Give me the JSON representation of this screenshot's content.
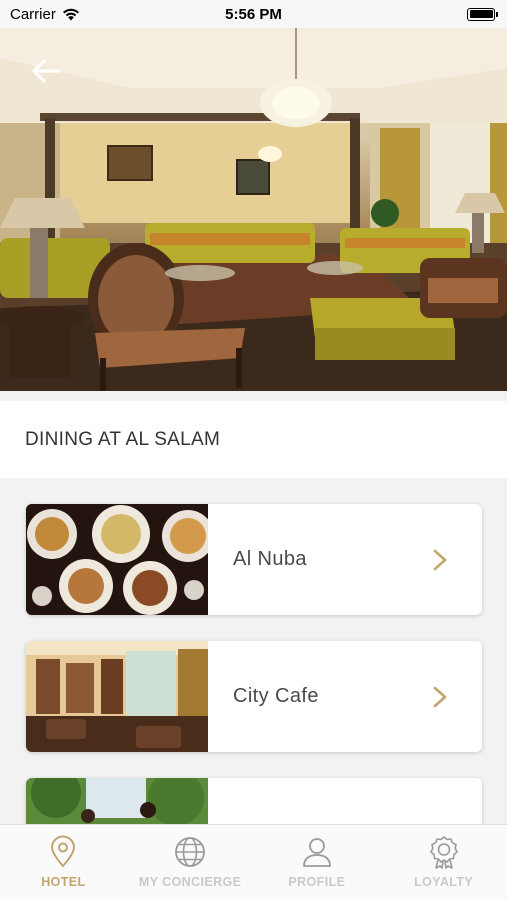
{
  "status_bar": {
    "carrier": "Carrier",
    "time": "5:56 PM",
    "battery_level": 1.0
  },
  "hero": {
    "back_icon": "arrow-left-icon"
  },
  "section": {
    "title": "DINING AT AL SALAM"
  },
  "venues": [
    {
      "name": "Al Nuba",
      "icon": "chevron-right-icon"
    },
    {
      "name": "City Cafe",
      "icon": "chevron-right-icon"
    },
    {
      "name": "",
      "icon": ""
    }
  ],
  "tabs": [
    {
      "label": "HOTEL",
      "icon": "location-pin-icon",
      "active": true
    },
    {
      "label": "MY CONCIERGE",
      "icon": "globe-icon",
      "active": false
    },
    {
      "label": "PROFILE",
      "icon": "user-icon",
      "active": false
    },
    {
      "label": "LOYALTY",
      "icon": "award-ribbon-icon",
      "active": false
    }
  ],
  "colors": {
    "accent": "#c2a470",
    "inactive": "#c9c9c9",
    "text": "#333333"
  }
}
